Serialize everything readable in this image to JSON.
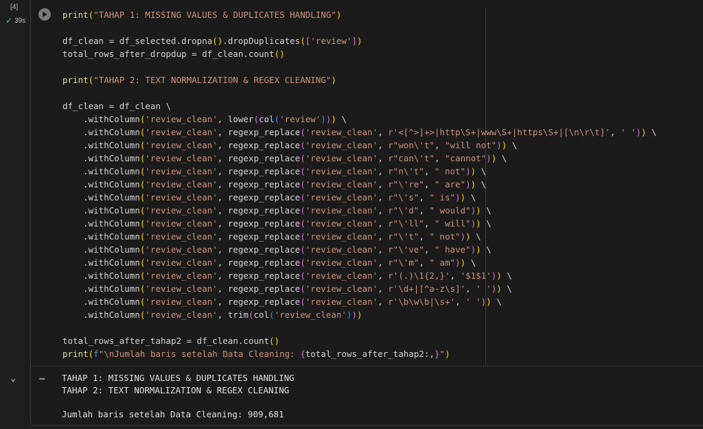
{
  "cell": {
    "execution_count": "[4]",
    "status_time": "39s",
    "status_icon": "check-icon"
  },
  "code": [
    [
      [
        "fn",
        "print"
      ],
      [
        "p1",
        "("
      ],
      [
        "str",
        "\"TAHAP 1: MISSING VALUES & DUPLICATES HANDLING\""
      ],
      [
        "p1",
        ")"
      ]
    ],
    [],
    [
      [
        "txt",
        "df_clean = df_selected.dropna"
      ],
      [
        "p1",
        "()"
      ],
      [
        "txt",
        ".dropDuplicates"
      ],
      [
        "p1",
        "("
      ],
      [
        "p2",
        "["
      ],
      [
        "str",
        "'review'"
      ],
      [
        "p2",
        "]"
      ],
      [
        "p1",
        ")"
      ]
    ],
    [
      [
        "txt",
        "total_rows_after_dropdup = df_clean.count"
      ],
      [
        "p1",
        "()"
      ]
    ],
    [],
    [
      [
        "fn",
        "print"
      ],
      [
        "p1",
        "("
      ],
      [
        "str",
        "\"TAHAP 2: TEXT NORMALIZATION & REGEX CLEANING\""
      ],
      [
        "p1",
        ")"
      ]
    ],
    [],
    [
      [
        "txt",
        "df_clean = df_clean \\"
      ]
    ],
    [
      [
        "txt",
        "    .withColumn"
      ],
      [
        "p1",
        "("
      ],
      [
        "str",
        "'review_clean'"
      ],
      [
        "txt",
        ", lower"
      ],
      [
        "p2",
        "("
      ],
      [
        "txt",
        "col"
      ],
      [
        "p3",
        "("
      ],
      [
        "str",
        "'review'"
      ],
      [
        "p3",
        ")"
      ],
      [
        "p2",
        ")"
      ],
      [
        "p1",
        ")"
      ],
      [
        "txt",
        " \\"
      ]
    ],
    [
      [
        "txt",
        "    .withColumn"
      ],
      [
        "p1",
        "("
      ],
      [
        "str",
        "'review_clean'"
      ],
      [
        "txt",
        ", regexp_replace"
      ],
      [
        "p2",
        "("
      ],
      [
        "str",
        "'review_clean'"
      ],
      [
        "txt",
        ", "
      ],
      [
        "str",
        "r'<[^>]+>|http\\S+|www\\S+|https\\S+|[\\n\\r\\t]'"
      ],
      [
        "txt",
        ", "
      ],
      [
        "str",
        "' '"
      ],
      [
        "p2",
        ")"
      ],
      [
        "p1",
        ")"
      ],
      [
        "txt",
        " \\"
      ]
    ],
    [
      [
        "txt",
        "    .withColumn"
      ],
      [
        "p1",
        "("
      ],
      [
        "str",
        "'review_clean'"
      ],
      [
        "txt",
        ", regexp_replace"
      ],
      [
        "p2",
        "("
      ],
      [
        "str",
        "'review_clean'"
      ],
      [
        "txt",
        ", "
      ],
      [
        "str",
        "r\"won\\'t\""
      ],
      [
        "txt",
        ", "
      ],
      [
        "str",
        "\"will not\""
      ],
      [
        "p2",
        ")"
      ],
      [
        "p1",
        ")"
      ],
      [
        "txt",
        " \\"
      ]
    ],
    [
      [
        "txt",
        "    .withColumn"
      ],
      [
        "p1",
        "("
      ],
      [
        "str",
        "'review_clean'"
      ],
      [
        "txt",
        ", regexp_replace"
      ],
      [
        "p2",
        "("
      ],
      [
        "str",
        "'review_clean'"
      ],
      [
        "txt",
        ", "
      ],
      [
        "str",
        "r\"can\\'t\""
      ],
      [
        "txt",
        ", "
      ],
      [
        "str",
        "\"cannot\""
      ],
      [
        "p2",
        ")"
      ],
      [
        "p1",
        ")"
      ],
      [
        "txt",
        " \\"
      ]
    ],
    [
      [
        "txt",
        "    .withColumn"
      ],
      [
        "p1",
        "("
      ],
      [
        "str",
        "'review_clean'"
      ],
      [
        "txt",
        ", regexp_replace"
      ],
      [
        "p2",
        "("
      ],
      [
        "str",
        "'review_clean'"
      ],
      [
        "txt",
        ", "
      ],
      [
        "str",
        "r\"n\\'t\""
      ],
      [
        "txt",
        ", "
      ],
      [
        "str",
        "\" not\""
      ],
      [
        "p2",
        ")"
      ],
      [
        "p1",
        ")"
      ],
      [
        "txt",
        " \\"
      ]
    ],
    [
      [
        "txt",
        "    .withColumn"
      ],
      [
        "p1",
        "("
      ],
      [
        "str",
        "'review_clean'"
      ],
      [
        "txt",
        ", regexp_replace"
      ],
      [
        "p2",
        "("
      ],
      [
        "str",
        "'review_clean'"
      ],
      [
        "txt",
        ", "
      ],
      [
        "str",
        "r\"\\'re\""
      ],
      [
        "txt",
        ", "
      ],
      [
        "str",
        "\" are\""
      ],
      [
        "p2",
        ")"
      ],
      [
        "p1",
        ")"
      ],
      [
        "txt",
        " \\"
      ]
    ],
    [
      [
        "txt",
        "    .withColumn"
      ],
      [
        "p1",
        "("
      ],
      [
        "str",
        "'review_clean'"
      ],
      [
        "txt",
        ", regexp_replace"
      ],
      [
        "p2",
        "("
      ],
      [
        "str",
        "'review_clean'"
      ],
      [
        "txt",
        ", "
      ],
      [
        "str",
        "r\"\\'s\""
      ],
      [
        "txt",
        ", "
      ],
      [
        "str",
        "\" is\""
      ],
      [
        "p2",
        ")"
      ],
      [
        "p1",
        ")"
      ],
      [
        "txt",
        " \\"
      ]
    ],
    [
      [
        "txt",
        "    .withColumn"
      ],
      [
        "p1",
        "("
      ],
      [
        "str",
        "'review_clean'"
      ],
      [
        "txt",
        ", regexp_replace"
      ],
      [
        "p2",
        "("
      ],
      [
        "str",
        "'review_clean'"
      ],
      [
        "txt",
        ", "
      ],
      [
        "str",
        "r\"\\'d\""
      ],
      [
        "txt",
        ", "
      ],
      [
        "str",
        "\" would\""
      ],
      [
        "p2",
        ")"
      ],
      [
        "p1",
        ")"
      ],
      [
        "txt",
        " \\"
      ]
    ],
    [
      [
        "txt",
        "    .withColumn"
      ],
      [
        "p1",
        "("
      ],
      [
        "str",
        "'review_clean'"
      ],
      [
        "txt",
        ", regexp_replace"
      ],
      [
        "p2",
        "("
      ],
      [
        "str",
        "'review_clean'"
      ],
      [
        "txt",
        ", "
      ],
      [
        "str",
        "r\"\\'ll\""
      ],
      [
        "txt",
        ", "
      ],
      [
        "str",
        "\" will\""
      ],
      [
        "p2",
        ")"
      ],
      [
        "p1",
        ")"
      ],
      [
        "txt",
        " \\"
      ]
    ],
    [
      [
        "txt",
        "    .withColumn"
      ],
      [
        "p1",
        "("
      ],
      [
        "str",
        "'review_clean'"
      ],
      [
        "txt",
        ", regexp_replace"
      ],
      [
        "p2",
        "("
      ],
      [
        "str",
        "'review_clean'"
      ],
      [
        "txt",
        ", "
      ],
      [
        "str",
        "r\"\\'t\""
      ],
      [
        "txt",
        ", "
      ],
      [
        "str",
        "\" not\""
      ],
      [
        "p2",
        ")"
      ],
      [
        "p1",
        ")"
      ],
      [
        "txt",
        " \\"
      ]
    ],
    [
      [
        "txt",
        "    .withColumn"
      ],
      [
        "p1",
        "("
      ],
      [
        "str",
        "'review_clean'"
      ],
      [
        "txt",
        ", regexp_replace"
      ],
      [
        "p2",
        "("
      ],
      [
        "str",
        "'review_clean'"
      ],
      [
        "txt",
        ", "
      ],
      [
        "str",
        "r\"\\'ve\""
      ],
      [
        "txt",
        ", "
      ],
      [
        "str",
        "\" have\""
      ],
      [
        "p2",
        ")"
      ],
      [
        "p1",
        ")"
      ],
      [
        "txt",
        " \\"
      ]
    ],
    [
      [
        "txt",
        "    .withColumn"
      ],
      [
        "p1",
        "("
      ],
      [
        "str",
        "'review_clean'"
      ],
      [
        "txt",
        ", regexp_replace"
      ],
      [
        "p2",
        "("
      ],
      [
        "str",
        "'review_clean'"
      ],
      [
        "txt",
        ", "
      ],
      [
        "str",
        "r\"\\'m\""
      ],
      [
        "txt",
        ", "
      ],
      [
        "str",
        "\" am\""
      ],
      [
        "p2",
        ")"
      ],
      [
        "p1",
        ")"
      ],
      [
        "txt",
        " \\"
      ]
    ],
    [
      [
        "txt",
        "    .withColumn"
      ],
      [
        "p1",
        "("
      ],
      [
        "str",
        "'review_clean'"
      ],
      [
        "txt",
        ", regexp_replace"
      ],
      [
        "p2",
        "("
      ],
      [
        "str",
        "'review_clean'"
      ],
      [
        "txt",
        ", "
      ],
      [
        "str",
        "r'(.)\\1{2,}'"
      ],
      [
        "txt",
        ", "
      ],
      [
        "str",
        "'$1$1'"
      ],
      [
        "p2",
        ")"
      ],
      [
        "p1",
        ")"
      ],
      [
        "txt",
        " \\"
      ]
    ],
    [
      [
        "txt",
        "    .withColumn"
      ],
      [
        "p1",
        "("
      ],
      [
        "str",
        "'review_clean'"
      ],
      [
        "txt",
        ", regexp_replace"
      ],
      [
        "p2",
        "("
      ],
      [
        "str",
        "'review_clean'"
      ],
      [
        "txt",
        ", "
      ],
      [
        "str",
        "r'\\d+|[^a-z\\s]'"
      ],
      [
        "txt",
        ", "
      ],
      [
        "str",
        "' '"
      ],
      [
        "p2",
        ")"
      ],
      [
        "p1",
        ")"
      ],
      [
        "txt",
        " \\"
      ]
    ],
    [
      [
        "txt",
        "    .withColumn"
      ],
      [
        "p1",
        "("
      ],
      [
        "str",
        "'review_clean'"
      ],
      [
        "txt",
        ", regexp_replace"
      ],
      [
        "p2",
        "("
      ],
      [
        "str",
        "'review_clean'"
      ],
      [
        "txt",
        ", "
      ],
      [
        "str",
        "r'\\b\\w\\b|\\s+'"
      ],
      [
        "txt",
        ", "
      ],
      [
        "str",
        "' '"
      ],
      [
        "p2",
        ")"
      ],
      [
        "p1",
        ")"
      ],
      [
        "txt",
        " \\"
      ]
    ],
    [
      [
        "txt",
        "    .withColumn"
      ],
      [
        "p1",
        "("
      ],
      [
        "str",
        "'review_clean'"
      ],
      [
        "txt",
        ", trim"
      ],
      [
        "p2",
        "("
      ],
      [
        "txt",
        "col"
      ],
      [
        "p3",
        "("
      ],
      [
        "str",
        "'review_clean'"
      ],
      [
        "p3",
        ")"
      ],
      [
        "p2",
        ")"
      ],
      [
        "p1",
        ")"
      ]
    ],
    [],
    [
      [
        "txt",
        "total_rows_after_tahap2 = df_clean.count"
      ],
      [
        "p1",
        "()"
      ]
    ],
    [
      [
        "fn",
        "print"
      ],
      [
        "p1",
        "("
      ],
      [
        "kw",
        "f"
      ],
      [
        "str",
        "\"\\nJumlah baris setelah Data Cleaning: "
      ],
      [
        "p2",
        "{"
      ],
      [
        "txt",
        "total_rows_after_tahap2:,"
      ],
      [
        "p2",
        "}"
      ],
      [
        "str",
        "\""
      ],
      [
        "p1",
        ")"
      ]
    ]
  ],
  "output": {
    "lines": [
      "TAHAP 1: MISSING VALUES & DUPLICATES HANDLING",
      "TAHAP 2: TEXT NORMALIZATION & REGEX CLEANING",
      "",
      "Jumlah baris setelah Data Cleaning: 909,681"
    ],
    "dots_label": "…"
  }
}
